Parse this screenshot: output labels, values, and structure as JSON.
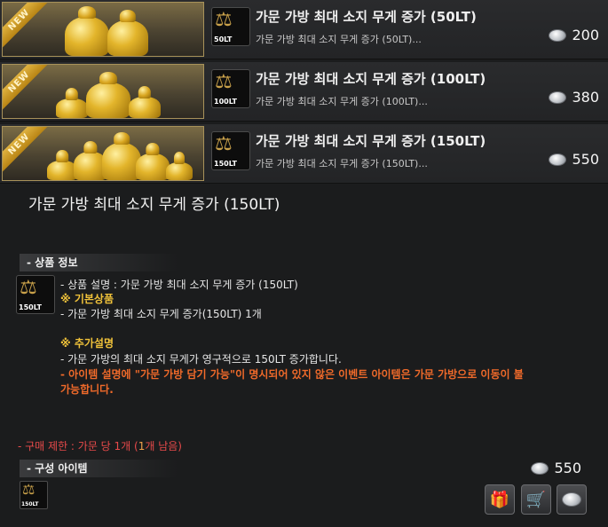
{
  "items": [
    {
      "badge": "NEW",
      "thumb_label": "50LT",
      "title": "가문 가방 최대 소지 무게 증가 (50LT)",
      "desc": "가문 가방 최대 소지 무게 증가 (50LT)...",
      "price": "200"
    },
    {
      "badge": "NEW",
      "thumb_label": "100LT",
      "title": "가문 가방 최대 소지 무게 증가 (100LT)",
      "desc": "가문 가방 최대 소지 무게 증가 (100LT)...",
      "price": "380"
    },
    {
      "badge": "NEW",
      "thumb_label": "150LT",
      "title": "가문 가방 최대 소지 무게 증가 (150LT)",
      "desc": "가문 가방 최대 소지 무게 증가 (150LT)...",
      "price": "550"
    }
  ],
  "detail": {
    "title": "가문 가방 최대 소지 무게 증가 (150LT)",
    "section_info": "- 상품 정보",
    "thumb_label": "150LT",
    "lines": [
      "- 상품 설명 : 가문 가방 최대 소지 무게 증가 (150LT)",
      "※ 기본상품",
      "- 가문 가방 최대 소지 무게 증가(150LT) 1개",
      "※ 추가설명",
      "- 가문 가방의 최대 소지 무게가 영구적으로 150LT 증가합니다.",
      "- 아이템 설명에 \"가문 가방 담기 가능\"이 명시되어 있지 않은 이벤트 아이템은 가문 가방으로 이동이 불",
      "가능합니다."
    ],
    "limit_prefix": "- 구매 제한 : 가문 당 1개 (",
    "limit_count": "1",
    "limit_suffix": "개 남음)",
    "section_components": "- 구성 아이템",
    "component_thumb_label": "150LT",
    "total_price": "550"
  },
  "buttons": {
    "gift": "gift-icon",
    "cart": "cart-icon",
    "coin": "coin-icon"
  },
  "colors": {
    "accent_yellow": "#f0c23a",
    "warning_orange": "#f06a2a",
    "limit_red": "#e84040"
  }
}
